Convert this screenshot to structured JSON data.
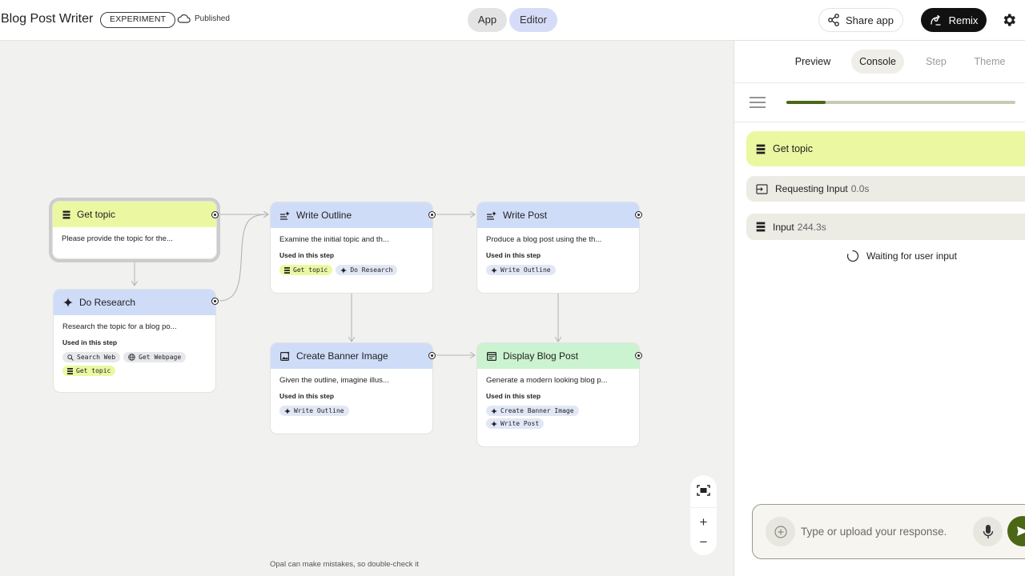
{
  "header": {
    "title": "Blog Post Writer",
    "badge": "EXPERIMENT",
    "status": "Published",
    "mode_app": "App",
    "mode_editor": "Editor",
    "share_label": "Share app",
    "remix_label": "Remix"
  },
  "nodes": {
    "get_topic": {
      "title": "Get topic",
      "desc": "Please provide the topic for the..."
    },
    "do_research": {
      "title": "Do Research",
      "desc": "Research the topic for a blog po...",
      "used_label": "Used in this step",
      "chips": [
        "Search Web",
        "Get Webpage",
        "Get topic"
      ]
    },
    "write_outline": {
      "title": "Write Outline",
      "desc": "Examine the initial topic and th...",
      "used_label": "Used in this step",
      "chips": [
        "Get topic",
        "Do Research"
      ]
    },
    "write_post": {
      "title": "Write Post",
      "desc": "Produce a blog post using the th...",
      "used_label": "Used in this step",
      "chips": [
        "Write Outline"
      ]
    },
    "create_banner": {
      "title": "Create Banner Image",
      "desc": "Given the outline, imagine illus...",
      "used_label": "Used in this step",
      "chips": [
        "Write Outline"
      ]
    },
    "display_post": {
      "title": "Display Blog Post",
      "desc": "Generate a modern looking blog p...",
      "used_label": "Used in this step",
      "chips": [
        "Create Banner Image",
        "Write Post"
      ]
    }
  },
  "canvas": {
    "disclaimer": "Opal can make mistakes, so double-check it",
    "zoom_in": "+",
    "zoom_out": "−"
  },
  "panel": {
    "tabs": [
      "Preview",
      "Console",
      "Step",
      "Theme"
    ],
    "active_tab": "Console",
    "progress": 0.17,
    "rows": {
      "topic": "Get topic",
      "requesting_label": "Requesting Input",
      "requesting_time": "0.0s",
      "input_label": "Input",
      "input_time": "244.3s"
    },
    "waiting": "Waiting for user input",
    "input_placeholder": "Type or upload your response."
  },
  "colors": {
    "yellow": "#ebf8a1",
    "blue": "#cfdcf8",
    "green": "#cbf3d0",
    "accent_olive": "#4b6614"
  }
}
